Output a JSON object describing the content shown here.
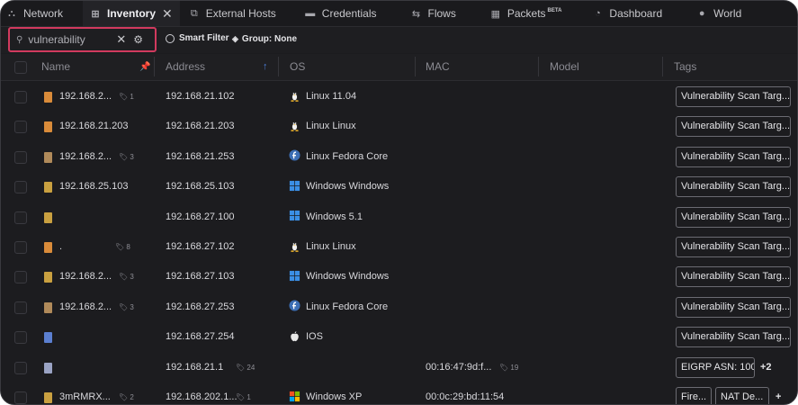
{
  "tabs": [
    {
      "label": "Network",
      "icon": "network-icon",
      "glyph": "⛬"
    },
    {
      "label": "Inventory",
      "icon": "inventory-icon",
      "glyph": "⊞",
      "active": true,
      "close": "✕"
    },
    {
      "label": "External Hosts",
      "icon": "external-hosts-icon",
      "glyph": "⧉"
    },
    {
      "label": "Credentials",
      "icon": "credentials-icon",
      "glyph": "▬"
    },
    {
      "label": "Flows",
      "icon": "flows-icon",
      "glyph": "⇆"
    },
    {
      "label": "Packets",
      "badge": "BETA",
      "icon": "packets-icon",
      "glyph": "▦"
    },
    {
      "label": "Dashboard",
      "icon": "dashboard-icon",
      "glyph": "◔"
    },
    {
      "label": "World",
      "icon": "world-icon",
      "glyph": "●"
    }
  ],
  "filter": {
    "search_value": "vulnerability",
    "smart_filter_label": "Smart Filter",
    "group_label": "Group: None"
  },
  "columns": {
    "name": "Name",
    "address": "Address",
    "os": "OS",
    "mac": "MAC",
    "model": "Model",
    "tags": "Tags"
  },
  "rows": [
    {
      "name": "192.168.2...",
      "name_tags": "1",
      "address": "192.168.21.102",
      "address_tags": "",
      "os": "Linux 11.04",
      "os_icon": "linux",
      "mac": "",
      "mac_tags": "",
      "tags": [
        "Vulnerability Scan Targ..."
      ],
      "extra": "",
      "icon_color": "#d98b3a"
    },
    {
      "name": "192.168.21.203",
      "name_tags": "",
      "address": "192.168.21.203",
      "address_tags": "",
      "os": "Linux Linux",
      "os_icon": "linux",
      "mac": "",
      "mac_tags": "",
      "tags": [
        "Vulnerability Scan Targ..."
      ],
      "extra": "",
      "icon_color": "#d98b3a"
    },
    {
      "name": "192.168.2...",
      "name_tags": "3",
      "address": "192.168.21.253",
      "address_tags": "",
      "os": "Linux Fedora Core",
      "os_icon": "fedora",
      "mac": "",
      "mac_tags": "",
      "tags": [
        "Vulnerability Scan Targ..."
      ],
      "extra": "",
      "icon_color": "#b08a5a"
    },
    {
      "name": "192.168.25.103",
      "name_tags": "",
      "address": "192.168.25.103",
      "address_tags": "",
      "os": "Windows Windows",
      "os_icon": "windows",
      "mac": "",
      "mac_tags": "",
      "tags": [
        "Vulnerability Scan Targ..."
      ],
      "extra": "",
      "icon_color": "#c9a040"
    },
    {
      "name": "",
      "name_tags": "",
      "address": "192.168.27.100",
      "address_tags": "",
      "os": "Windows 5.1",
      "os_icon": "windows",
      "mac": "",
      "mac_tags": "",
      "tags": [
        "Vulnerability Scan Targ..."
      ],
      "extra": "",
      "icon_color": "#c9a040"
    },
    {
      "name": ".",
      "name_tags": "8",
      "address": "192.168.27.102",
      "address_tags": "",
      "os": "Linux Linux",
      "os_icon": "linux",
      "mac": "",
      "mac_tags": "",
      "tags": [
        "Vulnerability Scan Targ..."
      ],
      "extra": "",
      "icon_color": "#d98b3a"
    },
    {
      "name": "192.168.2...",
      "name_tags": "3",
      "address": "192.168.27.103",
      "address_tags": "",
      "os": "Windows Windows",
      "os_icon": "windows",
      "mac": "",
      "mac_tags": "",
      "tags": [
        "Vulnerability Scan Targ..."
      ],
      "extra": "",
      "icon_color": "#c9a040"
    },
    {
      "name": "192.168.2...",
      "name_tags": "3",
      "address": "192.168.27.253",
      "address_tags": "",
      "os": "Linux Fedora Core",
      "os_icon": "fedora",
      "mac": "",
      "mac_tags": "",
      "tags": [
        "Vulnerability Scan Targ..."
      ],
      "extra": "",
      "icon_color": "#b08a5a"
    },
    {
      "name": "",
      "name_tags": "",
      "address": "192.168.27.254",
      "address_tags": "",
      "os": "IOS",
      "os_icon": "apple",
      "mac": "",
      "mac_tags": "",
      "tags": [
        "Vulnerability Scan Targ..."
      ],
      "extra": "",
      "icon_color": "#5b7fd0"
    },
    {
      "name": "",
      "name_tags": "",
      "address": "192.168.21.1",
      "address_tags": "24",
      "os": "",
      "os_icon": "",
      "mac": "00:16:47:9d:f...",
      "mac_tags": "19",
      "tags": [
        "EIGRP ASN: 100"
      ],
      "extra": "+2",
      "icon_color": "#9aa3c4"
    },
    {
      "name": "3mRMRX...",
      "name_tags": "2",
      "address": "192.168.202.1...",
      "address_tags": "1",
      "os": "Windows XP",
      "os_icon": "winxp",
      "mac": "00:0c:29:bd:11:54",
      "mac_tags": "",
      "tags": [
        "Fire...",
        "NAT De..."
      ],
      "extra": "+",
      "icon_color": "#c9a040"
    }
  ],
  "colors": {
    "background": "#1c1c1f",
    "search_highlight": "#d13a5e",
    "accent": "#4d7fd9"
  }
}
